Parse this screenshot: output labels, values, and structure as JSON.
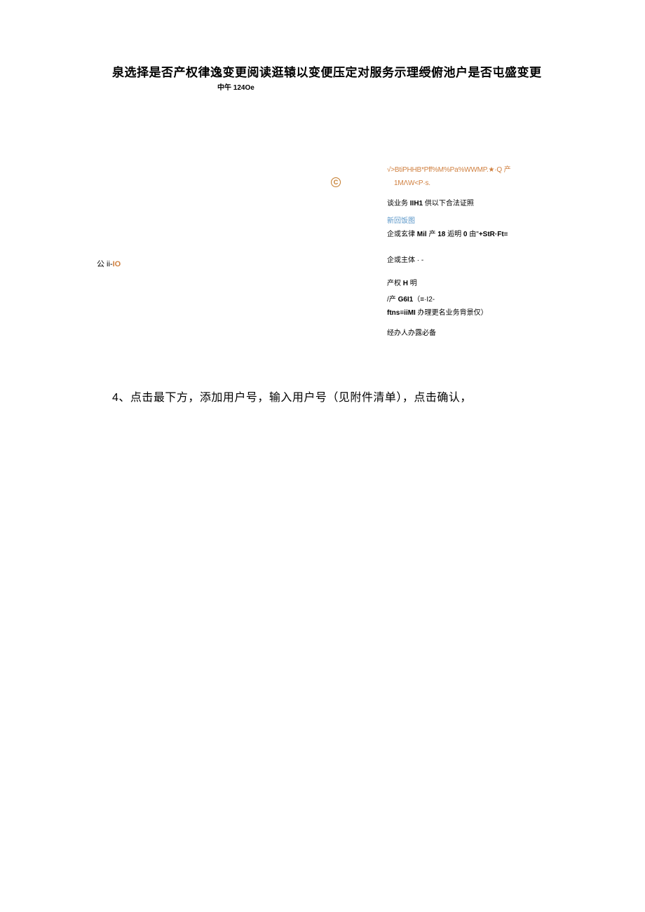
{
  "title": "泉选择是否产权律逸变更阅读逛辕以变便压定对服务示理绶俯池户是否屯盛变更",
  "subtitle": "中午 124Oe",
  "left_label_prefix": "公 ii-",
  "left_label_suffix": "IO",
  "c_icon": "C",
  "right": {
    "line1": "√>BtiPHHB*Pff%M%Pa%WWMP.★·Q 产",
    "line2": "1MΛW<P·s.",
    "line3_prefix": "谈业务 ",
    "line3_bold": "IIH1",
    "line3_suffix": " 供以下合法证照",
    "blue_link": "新回饭图",
    "line4_prefix": "企或玄律 ",
    "line4_bold1": "Mil",
    "line4_mid": " 产 ",
    "line4_bold2": "18",
    "line4_mid2": " 逅明    ",
    "line4_bold3": "0",
    "line4_mid3": " 由",
    "line4_quote": "\"",
    "line4_bold4": "+StR·Ft≡",
    "line5": "企或主体 · -",
    "line6_prefix": "产权 ",
    "line6_bold": "H",
    "line6_suffix": " 明",
    "line7_prefix": "/产 ",
    "line7_bold": "G6I1",
    "line7_suffix": "（≡·I2-",
    "line8_bold": "ftns≡iiMI",
    "line8_suffix": " 办理更名业务背景仅）",
    "line9": "经办人办露必备"
  },
  "step4": "4、点击最下方，添加用户号，输入用户号（见附件清单），点击确认，"
}
